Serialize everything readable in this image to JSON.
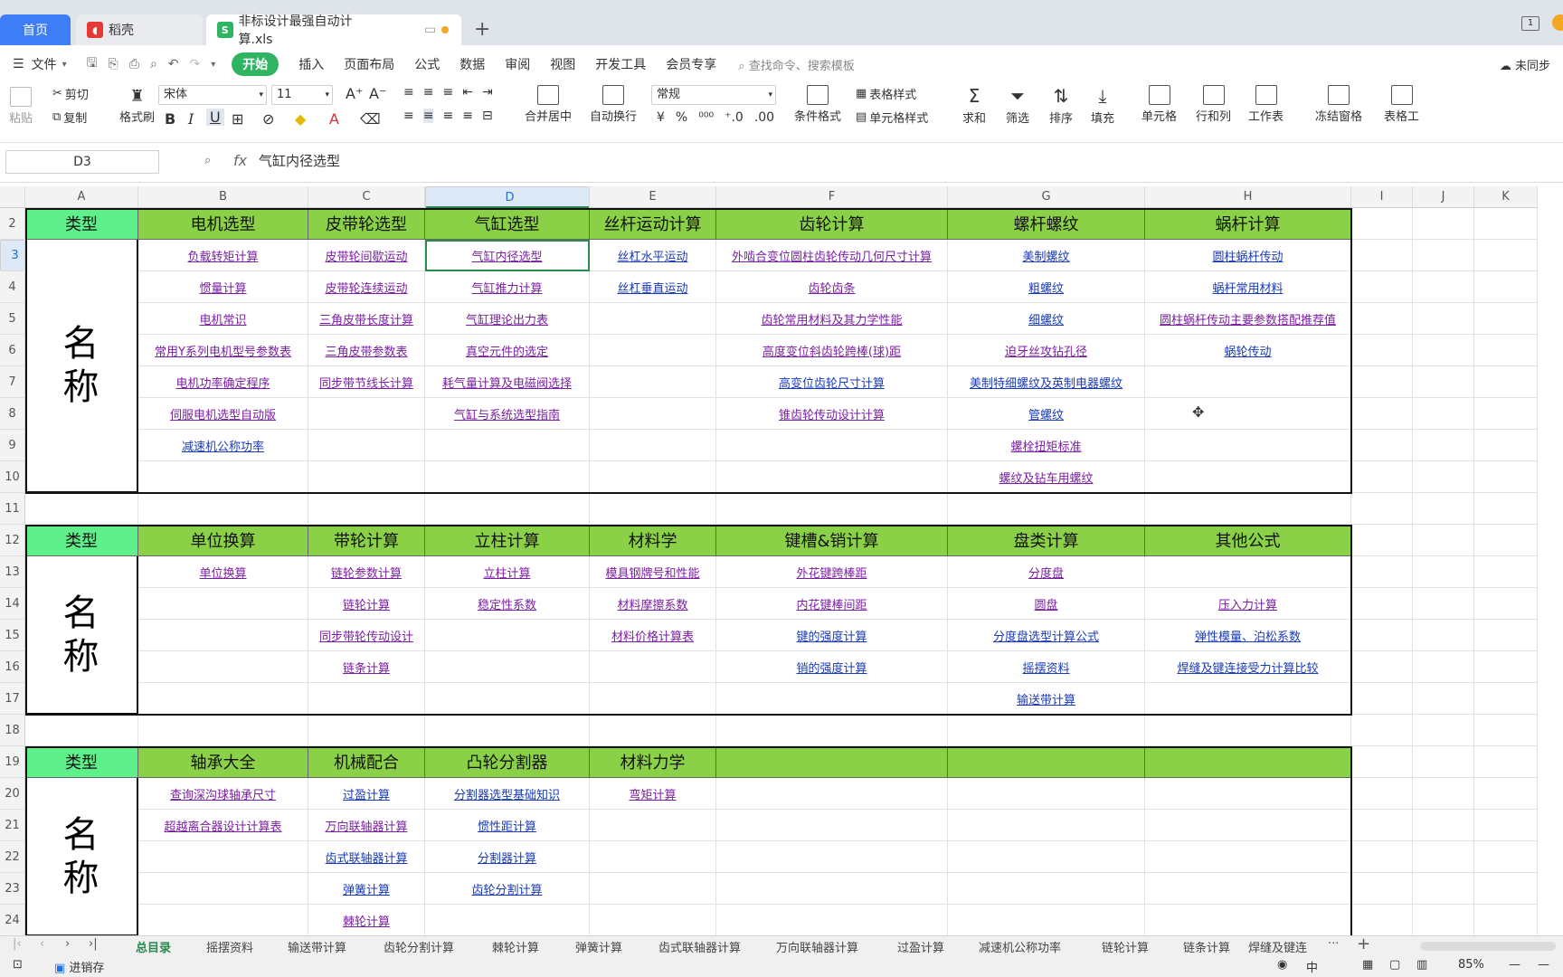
{
  "tabs": {
    "home": "首页",
    "daoke": "稻壳",
    "file": "非标设计最强自动计算.xls"
  },
  "menu": {
    "file": "文件",
    "items": [
      "开始",
      "插入",
      "页面布局",
      "公式",
      "数据",
      "审阅",
      "视图",
      "开发工具",
      "会员专享"
    ],
    "search_placeholder": "查找命令、搜索模板",
    "sync": "未同步"
  },
  "ribbon": {
    "paste": "粘贴",
    "cut": "剪切",
    "copy": "复制",
    "format_painter": "格式刷",
    "font_name": "宋体",
    "font_size": "11",
    "merge_center": "合并居中",
    "wrap": "自动换行",
    "number_format": "常规",
    "table_style": "表格样式",
    "cell_style": "单元格样式",
    "cond_format": "条件格式",
    "sum": "求和",
    "filter": "筛选",
    "sort": "排序",
    "fill": "填充",
    "cell": "单元格",
    "rowcol": "行和列",
    "worksheet": "工作表",
    "freeze": "冻结窗格",
    "table_tools": "表格工"
  },
  "formula": {
    "cell_ref": "D3",
    "fx": "fx",
    "content": "气缸内径选型"
  },
  "columns": [
    "A",
    "B",
    "C",
    "D",
    "E",
    "F",
    "G",
    "H",
    "I",
    "J",
    "K"
  ],
  "rows": [
    "2",
    "3",
    "4",
    "5",
    "6",
    "7",
    "8",
    "9",
    "10",
    "11",
    "12",
    "13",
    "14",
    "15",
    "16",
    "17",
    "18",
    "19",
    "20",
    "21",
    "22",
    "23",
    "24"
  ],
  "sections": [
    {
      "type_label": "类型",
      "name_top": "名",
      "name_bottom": "称",
      "headers": [
        "电机选型",
        "皮带轮选型",
        "气缸选型",
        "丝杆运动计算",
        "齿轮计算",
        "螺杆螺纹",
        "蜗杆计算"
      ],
      "cells": [
        [
          "负载转矩计算",
          "皮带轮间歇运动",
          "气缸内径选型",
          "丝杠水平运动",
          "外啮合变位圆柱齿轮传动几何尺寸计算",
          "美制螺纹",
          "圆柱蜗杆传动"
        ],
        [
          "惯量计算",
          "皮带轮连续运动",
          "气缸推力计算",
          "丝杠垂直运动",
          "齿轮齿条",
          "粗螺纹",
          "蜗杆常用材料"
        ],
        [
          "电机常识",
          "三角皮带长度计算",
          "气缸理论出力表",
          "",
          "齿轮常用材料及其力学性能",
          "细螺纹",
          "圆柱蜗杆传动主要参数搭配推荐值"
        ],
        [
          "常用Y系列电机型号参数表",
          "三角皮带参数表",
          "真空元件的选定",
          "",
          "高度变位斜齿轮跨棒(球)距",
          "迫牙丝攻钻孔径",
          "蜗轮传动"
        ],
        [
          "电机功率确定程序",
          "同步带节线长计算",
          "耗气量计算及电磁阀选择",
          "",
          "高变位齿轮尺寸计算",
          "美制特细螺纹及英制电器螺纹",
          ""
        ],
        [
          "伺服电机选型自动版",
          "",
          "气缸与系统选型指南",
          "",
          "锥齿轮传动设计计算",
          "管螺纹",
          ""
        ],
        [
          "减速机公称功率",
          "",
          "",
          "",
          "",
          "螺栓扭矩标准",
          ""
        ],
        [
          "",
          "",
          "",
          "",
          "",
          "螺纹及钻车用螺纹",
          ""
        ]
      ]
    },
    {
      "type_label": "类型",
      "name_top": "名",
      "name_bottom": "称",
      "headers": [
        "单位换算",
        "带轮计算",
        "立柱计算",
        "材料学",
        "键槽&销计算",
        "盘类计算",
        "其他公式"
      ],
      "cells": [
        [
          "单位换算",
          "链轮参数计算",
          "立柱计算",
          "模具钢牌号和性能",
          "外花键跨棒距",
          "分度盘",
          ""
        ],
        [
          "",
          "链轮计算",
          "稳定性系数",
          "材料摩擦系数",
          "内花键棒间距",
          "圆盘",
          "压入力计算"
        ],
        [
          "",
          "同步带轮传动设计",
          "",
          "材料价格计算表",
          "键的强度计算",
          "分度盘选型计算公式",
          "弹性模量、泊松系数"
        ],
        [
          "",
          "链条计算",
          "",
          "",
          "销的强度计算",
          "摇摆资料",
          "焊缝及键连接受力计算比较"
        ],
        [
          "",
          "",
          "",
          "",
          "",
          "输送带计算",
          ""
        ]
      ]
    },
    {
      "type_label": "类型",
      "name_top": "名",
      "name_bottom": "称",
      "headers": [
        "轴承大全",
        "机械配合",
        "凸轮分割器",
        "材料力学",
        "",
        "",
        ""
      ],
      "cells": [
        [
          "查询深沟球轴承尺寸",
          "过盈计算",
          "分割器选型基础知识",
          "弯矩计算",
          "",
          "",
          ""
        ],
        [
          "超越离合器设计计算表",
          "万向联轴器计算",
          "惯性距计算",
          "",
          "",
          "",
          ""
        ],
        [
          "",
          "齿式联轴器计算",
          "分割器计算",
          "",
          "",
          "",
          ""
        ],
        [
          "",
          "弹簧计算",
          "齿轮分割计算",
          "",
          "",
          "",
          ""
        ],
        [
          "",
          "棘轮计算",
          "",
          "",
          "",
          "",
          ""
        ]
      ]
    }
  ],
  "sheet_tabs": [
    "总目录",
    "摇摆资料",
    "输送带计算",
    "齿轮分割计算",
    "棘轮计算",
    "弹簧计算",
    "齿式联轴器计算",
    "万向联轴器计算",
    "过盈计算",
    "减速机公称功率",
    "链轮计算",
    "链条计算",
    "焊缝及键连"
  ],
  "status": {
    "left": "进销存",
    "zoom": "85%"
  },
  "colors": {
    "header_green": "#8bd148",
    "type_green": "#5ff08b",
    "accent": "#2fb562",
    "link_purple": "#7b1fa2",
    "link_blue": "#1a3bb5"
  }
}
